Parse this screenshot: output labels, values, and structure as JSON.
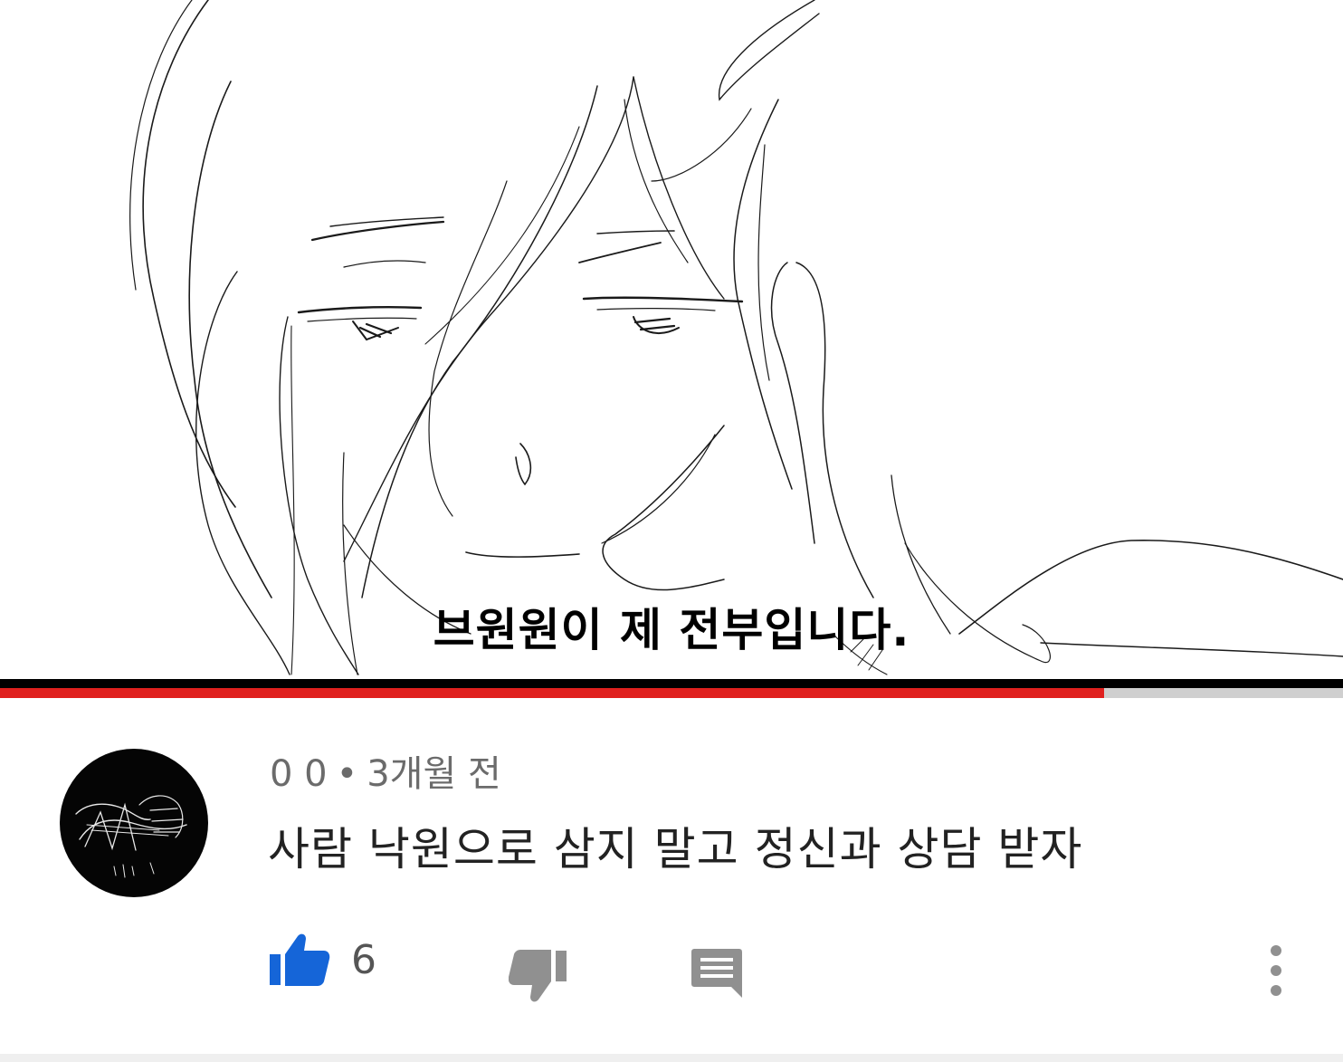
{
  "video": {
    "subtitle": "브원원이 제 전부입니다.",
    "progress_fraction": 0.822,
    "colors": {
      "progress": "#e0201e",
      "track": "#cfcfcf",
      "bar": "#000000"
    }
  },
  "comment": {
    "author": "0 0",
    "separator": "•",
    "time": "3개월 전",
    "text": "사람 낙원으로 삼지 말고 정신과 상담 받자",
    "avatar_icon": "sketch-avatar-icon"
  },
  "actions": {
    "like_icon": "thumbs-up-icon",
    "like_count": "6",
    "dislike_icon": "thumbs-down-icon",
    "reply_icon": "reply-comment-icon",
    "more_icon": "more-vertical-icon",
    "colors": {
      "like_active": "#1565d8",
      "icon": "#909090"
    }
  }
}
